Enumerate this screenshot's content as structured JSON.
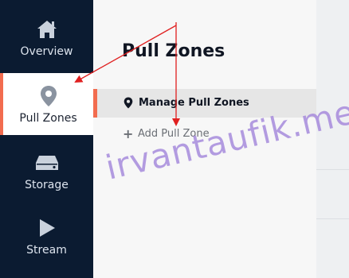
{
  "sidebar": {
    "items": [
      {
        "label": "Overview",
        "icon": "home-icon"
      },
      {
        "label": "Pull Zones",
        "icon": "map-pin-icon"
      },
      {
        "label": "Storage",
        "icon": "storage-icon"
      },
      {
        "label": "Stream",
        "icon": "play-icon"
      }
    ],
    "active_index": 1
  },
  "panel": {
    "title": "Pull Zones",
    "menu": [
      {
        "label": "Manage Pull Zones",
        "icon": "map-pin-icon"
      },
      {
        "label": "Add Pull Zone",
        "icon": "plus-icon"
      }
    ]
  },
  "watermark": "irvantaufik.me",
  "colors": {
    "sidebar_bg": "#0b1b31",
    "accent": "#f26c4f",
    "arrow": "#e02020",
    "watermark": "#a78bdc"
  }
}
